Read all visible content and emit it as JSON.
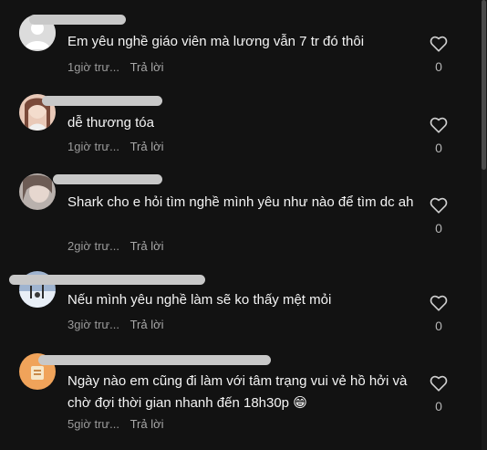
{
  "comments": [
    {
      "avatar": "default-user-avatar",
      "text": "Em yêu nghề giáo viên mà lương vẫn 7 tr đó thôi",
      "time": "1giờ trư...",
      "reply": "Trả lời",
      "likes": "0",
      "like_icon": "heart-outline-icon"
    },
    {
      "avatar": "user-photo-avatar",
      "text": "dễ thương tóa",
      "time": "1giờ trư...",
      "reply": "Trả lời",
      "likes": "0",
      "like_icon": "heart-outline-icon"
    },
    {
      "avatar": "user-photo-avatar",
      "text": "Shark cho e hỏi tìm nghề mình yêu như nào để tìm dc ah",
      "time": "2giờ trư...",
      "reply": "Trả lời",
      "likes": "0",
      "like_icon": "heart-outline-icon"
    },
    {
      "avatar": "user-photo-avatar",
      "text": "Nếu mình yêu nghề làm sẽ ko thấy mệt mỏi",
      "time": "3giờ trư...",
      "reply": "Trả lời",
      "likes": "0",
      "like_icon": "heart-outline-icon"
    },
    {
      "avatar": "user-illustration-avatar",
      "text": "Ngày nào em cũng đi làm với tâm trạng vui vẻ hồ hởi và chờ đợi thời gian nhanh đến 18h30p 😁",
      "time": "5giờ trư...",
      "reply": "Trả lời",
      "likes": "0",
      "like_icon": "heart-outline-icon"
    }
  ],
  "colors": {
    "background": "#121212",
    "text": "#f4f4f4",
    "meta": "#9a9a9a",
    "redacted_name": "#c8c8c8"
  }
}
